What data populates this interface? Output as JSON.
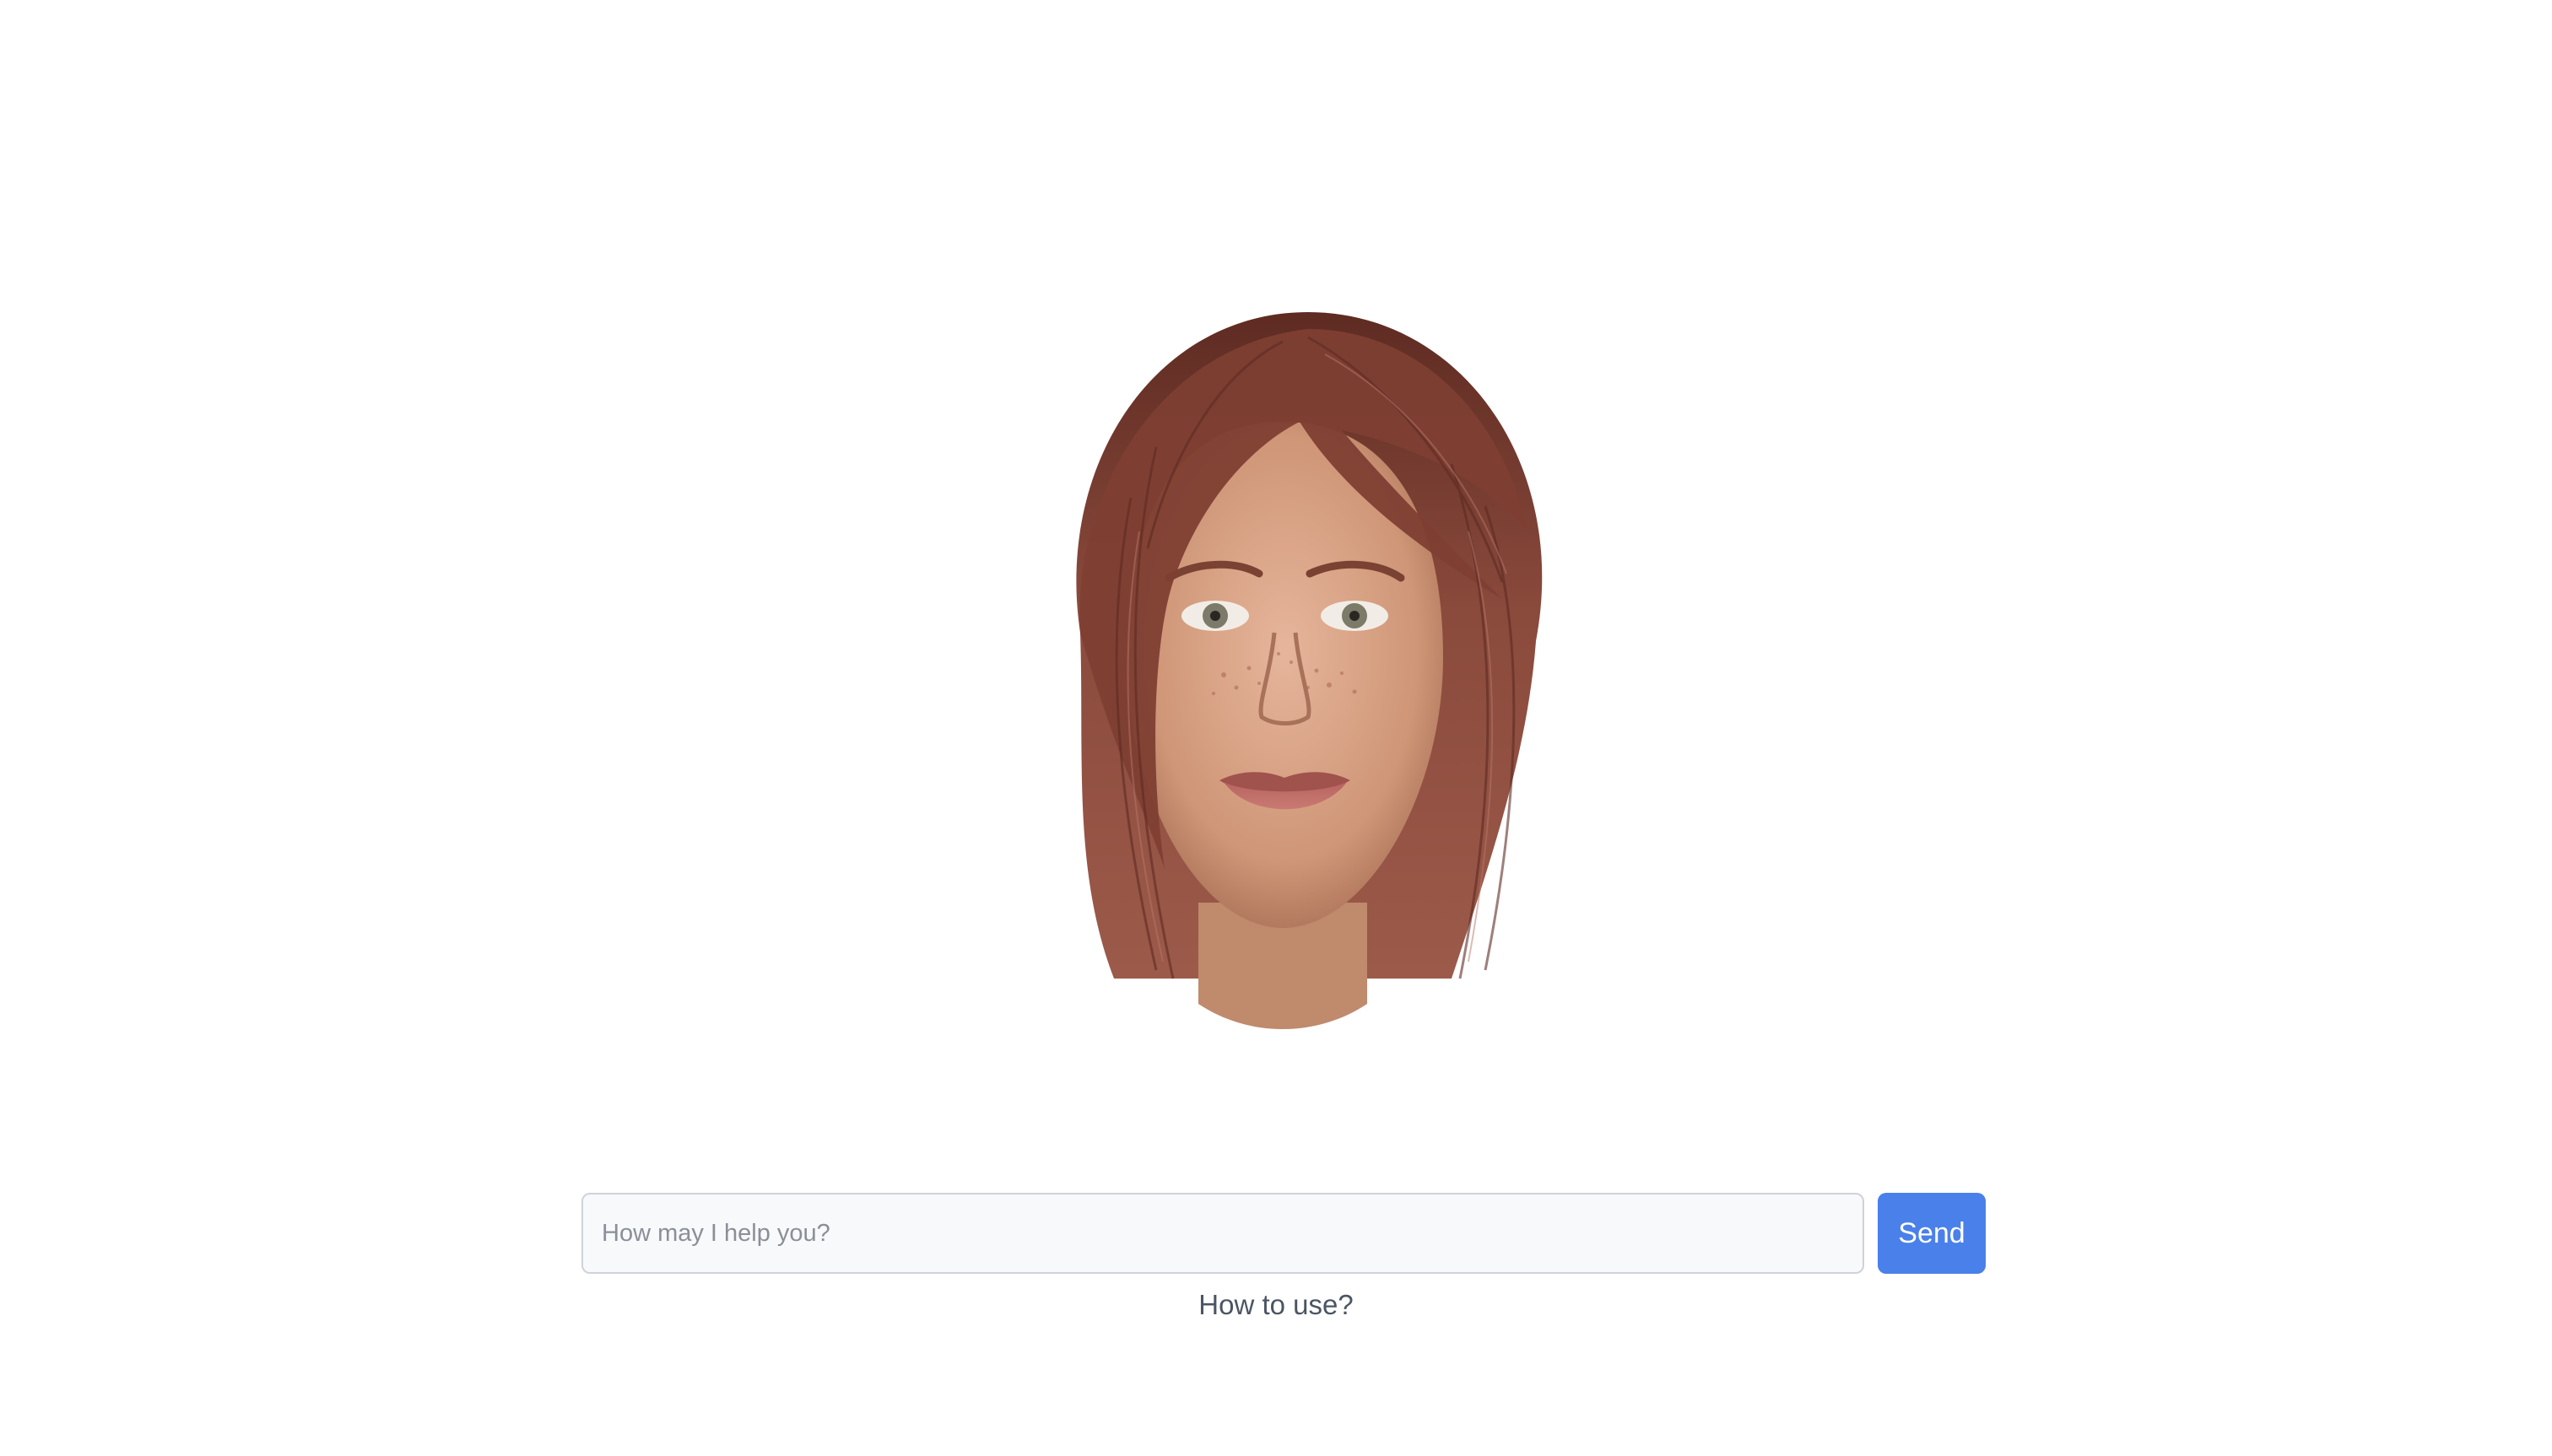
{
  "avatar": {
    "icon": "3d-avatar-head",
    "hair_color": "#8a4a3c",
    "skin_color": "#d9a489"
  },
  "chat": {
    "input_value": "",
    "input_placeholder": "How may I help you?",
    "send_label": "Send",
    "accent_color": "#4a80ea"
  },
  "help": {
    "link_text": "How to use?"
  }
}
